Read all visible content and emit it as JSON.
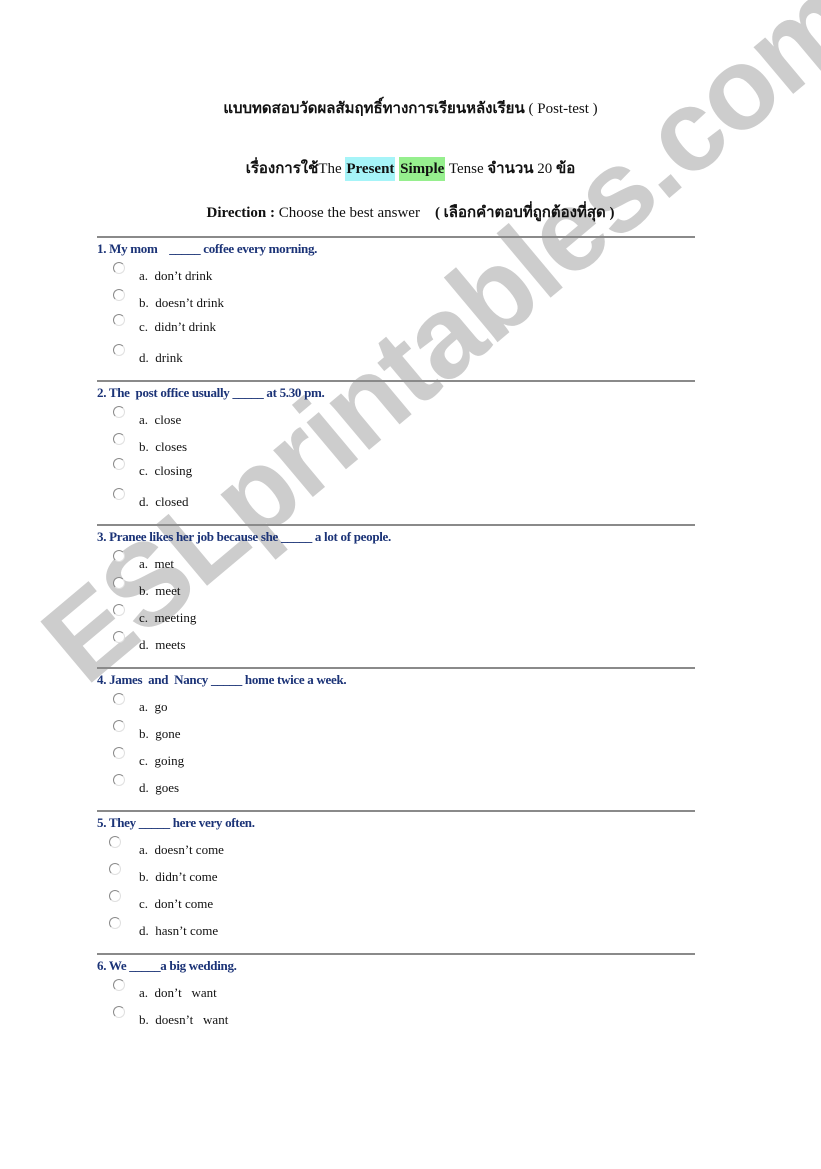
{
  "header": {
    "title_thai": "แบบทดสอบวัดผลสัมฤทธิ์ทางการเรียนหลังเรียน",
    "title_en": "( Post-test )",
    "subtitle_thai_prefix": "เรื่องการใช้",
    "subtitle_the": "The",
    "subtitle_present": "Present",
    "subtitle_simple": "Simple",
    "subtitle_tense": "Tense",
    "subtitle_count_thai": "จำนวน",
    "subtitle_count": "20",
    "subtitle_items_thai": "ข้อ",
    "direction_label": "Direction :",
    "direction_text": "Choose the best answer",
    "direction_thai": "( เลือกคำตอบที่ถูกต้องที่สุด )",
    "highlight_colors": {
      "present": "#a6f4f8",
      "simple": "#96ef8e"
    }
  },
  "questions": [
    {
      "stem": "1. My mom    _____ coffee every morning.",
      "options": [
        "a.  don’t drink",
        "b.  doesn’t drink",
        "c.  didn’t drink",
        "d.  drink"
      ]
    },
    {
      "stem": "2. The  post office usually _____ at 5.30 pm.",
      "options": [
        "a.  close",
        "b.  closes",
        "c.  closing",
        "d.  closed"
      ]
    },
    {
      "stem": "3. Pranee likes her job because she _____ a lot of people.",
      "options": [
        "a.  met",
        "b.  meet",
        "c.  meeting",
        "d.  meets"
      ]
    },
    {
      "stem": "4. James  and  Nancy _____ home twice a week.",
      "options": [
        "a.  go",
        "b.  gone",
        "c.  going",
        "d.  goes"
      ]
    },
    {
      "stem": "5. They _____ here very often.",
      "options": [
        "a.  doesn’t come",
        "b.  didn’t come",
        "c.  don’t come",
        "d.  hasn’t come"
      ]
    },
    {
      "stem": "6. We _____a big wedding.",
      "options": [
        "a.  don’t   want",
        "b.  doesn’t   want"
      ]
    }
  ],
  "watermark": {
    "text": "ESLprintables.com",
    "color": "#c9c9c9"
  },
  "colors": {
    "question_text": "#1b3377",
    "rule": "#8a8a8a"
  }
}
